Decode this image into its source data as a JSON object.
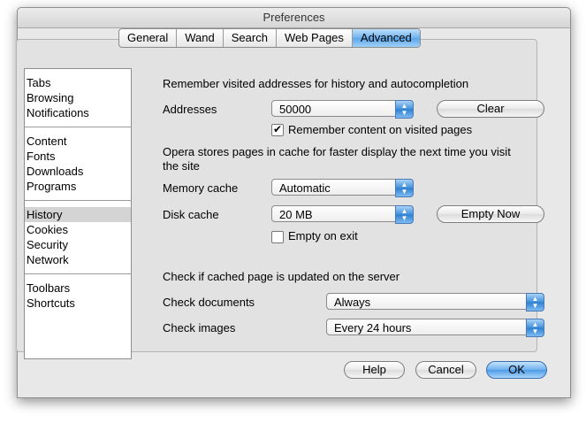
{
  "window": {
    "title": "Preferences"
  },
  "tabs": [
    {
      "label": "General"
    },
    {
      "label": "Wand"
    },
    {
      "label": "Search"
    },
    {
      "label": "Web Pages"
    },
    {
      "label": "Advanced"
    }
  ],
  "sidebar": {
    "groups": [
      [
        "Tabs",
        "Browsing",
        "Notifications"
      ],
      [
        "Content",
        "Fonts",
        "Downloads",
        "Programs"
      ],
      [
        "History",
        "Cookies",
        "Security",
        "Network"
      ],
      [
        "Toolbars",
        "Shortcuts"
      ]
    ],
    "selected": "History"
  },
  "history": {
    "remember_heading": "Remember visited addresses for history and autocompletion",
    "addresses_label": "Addresses",
    "addresses_value": "50000",
    "clear_label": "Clear",
    "remember_content_label": "Remember content on visited pages",
    "remember_content_checked": true,
    "cache_heading": "Opera stores pages in cache for faster display the next time you visit the site",
    "memory_cache_label": "Memory cache",
    "memory_cache_value": "Automatic",
    "disk_cache_label": "Disk cache",
    "disk_cache_value": "20 MB",
    "empty_now_label": "Empty Now",
    "empty_on_exit_label": "Empty on exit",
    "empty_on_exit_checked": false,
    "check_heading": "Check if cached page is updated on the server",
    "check_documents_label": "Check documents",
    "check_documents_value": "Always",
    "check_images_label": "Check images",
    "check_images_value": "Every 24 hours"
  },
  "footer": {
    "help_label": "Help",
    "cancel_label": "Cancel",
    "ok_label": "OK"
  },
  "colors": {
    "accent": "#5aa6ea"
  }
}
